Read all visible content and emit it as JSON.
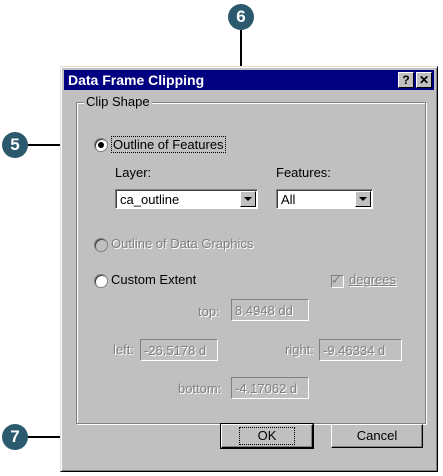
{
  "callouts": {
    "five": "5",
    "six": "6",
    "seven": "7"
  },
  "dialog": {
    "title": "Data Frame Clipping",
    "help_glyph": "?",
    "close_glyph": "✕",
    "group_label": "Clip Shape",
    "outline_features": {
      "label": "Outline of Features",
      "selected": true,
      "layer_label": "Layer:",
      "layer_value": "ca_outline",
      "features_label": "Features:",
      "features_value": "All"
    },
    "outline_graphics": {
      "label": "Outline of Data Graphics",
      "enabled": false
    },
    "custom_extent": {
      "label": "Custom Extent",
      "degrees_label": "degrees",
      "degrees_checked": true,
      "top_label": "top:",
      "top_value": "8.4948 dd",
      "left_label": "left:",
      "left_value": "-26.5178 d",
      "right_label": "right:",
      "right_value": "-9.46334 d",
      "bottom_label": "bottom:",
      "bottom_value": "-4.17062 d"
    },
    "ok_label": "OK",
    "cancel_label": "Cancel"
  },
  "colors": {
    "titlebar": "#000080",
    "callout": "#2b5a6e",
    "face": "#c0c0c0"
  },
  "icons": {
    "dropdown": "chevron-down-icon",
    "check": "check-icon",
    "help": "help-icon",
    "close": "close-icon"
  }
}
